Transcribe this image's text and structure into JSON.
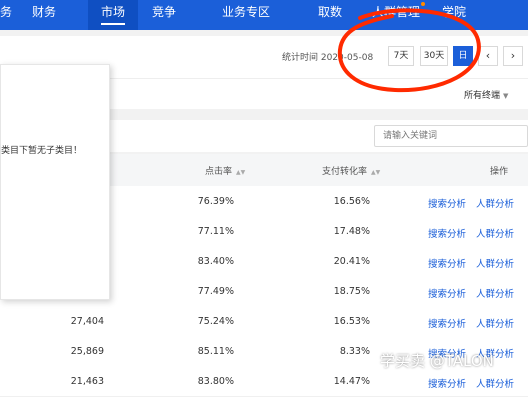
{
  "nav": {
    "items": [
      "财务",
      "市场",
      "竞争",
      "业务专区",
      "取数",
      "人群管理",
      "学院"
    ],
    "partial_first": "务",
    "active_index": 1
  },
  "filter": {
    "stat_time_label": "统计时间 2020-05-08",
    "buttons": [
      "7天",
      "30天",
      "日"
    ],
    "active_button": "日",
    "prev_icon": "chevron-left-icon",
    "next_icon": "chevron-right-icon"
  },
  "terminal": {
    "label": "所有终端"
  },
  "popup": {
    "message": "类目下暂无子类目！"
  },
  "search": {
    "placeholder": "请输入关键词"
  },
  "table": {
    "headers": {
      "ctr": "点击率",
      "pay_conv": "支付转化率",
      "actions": "操作"
    },
    "rows": [
      {
        "search": "",
        "ctr": "76.39%",
        "conv": "16.56%",
        "a1": "搜索分析",
        "a2": "人群分析"
      },
      {
        "search": "",
        "ctr": "77.11%",
        "conv": "17.48%",
        "a1": "搜索分析",
        "a2": "人群分析"
      },
      {
        "search": "",
        "ctr": "83.40%",
        "conv": "20.41%",
        "a1": "搜索分析",
        "a2": "人群分析"
      },
      {
        "search": "",
        "ctr": "77.49%",
        "conv": "18.75%",
        "a1": "搜索分析",
        "a2": "人群分析"
      },
      {
        "search": "27,404",
        "ctr": "75.24%",
        "conv": "16.53%",
        "a1": "搜索分析",
        "a2": "人群分析"
      },
      {
        "search": "25,869",
        "ctr": "85.11%",
        "conv": "8.33%",
        "a1": "搜索分析",
        "a2": "人群分析"
      },
      {
        "search": "21,463",
        "ctr": "83.80%",
        "conv": "14.47%",
        "a1": "搜索分析",
        "a2": "人群分析"
      }
    ]
  },
  "watermark": "学买卖 @TALON",
  "colors": {
    "nav_bg": "#1b5fd9",
    "link": "#1b5fd9",
    "annotation": "#ff2a00"
  }
}
